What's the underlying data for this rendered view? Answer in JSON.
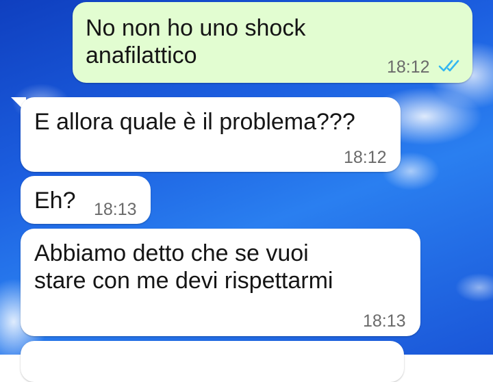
{
  "messages": [
    {
      "direction": "outgoing",
      "text": "No non ho uno shock\nanafilattico",
      "time": "18:12",
      "status": "read"
    },
    {
      "direction": "incoming",
      "text": "E allora quale è il problema???",
      "time": "18:12"
    },
    {
      "direction": "incoming",
      "text": "Eh?",
      "time": "18:13"
    },
    {
      "direction": "incoming",
      "text": "Abbiamo detto che se vuoi\nstare con me devi rispettarmi",
      "time": "18:13"
    }
  ],
  "icons": {
    "read_receipt": "double-check-icon"
  },
  "colors": {
    "outgoing_bubble": "#e2fdd1",
    "incoming_bubble": "#ffffff",
    "read_tick": "#34b7f1",
    "time_text": "#6a6a6a"
  }
}
